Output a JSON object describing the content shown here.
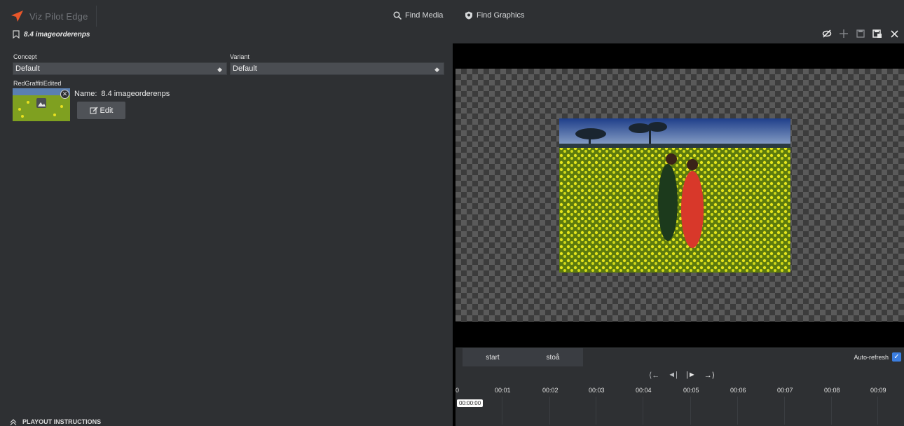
{
  "app": {
    "title": "Viz Pilot Edge"
  },
  "nav": {
    "find_media": "Find Media",
    "find_graphics": "Find Graphics"
  },
  "document": {
    "title": "8.4 imageorderenps"
  },
  "form": {
    "concept_label": "Concept",
    "concept_value": "Default",
    "variant_label": "Variant",
    "variant_value": "Default"
  },
  "asset": {
    "field_label": "RedGraffitiEdited",
    "name_label": "Name:",
    "name_value": "8.4 imageorderenps",
    "edit_label": "Edit"
  },
  "playout": {
    "label": "PLAYOUT INSTRUCTIONS"
  },
  "timeline": {
    "tabs": [
      "start",
      "stoå"
    ],
    "autorefresh_label": "Auto-refresh",
    "autorefresh_checked": true,
    "current_time": "00:00:00",
    "ticks": [
      "0",
      "00:01",
      "00:02",
      "00:03",
      "00:04",
      "00:05",
      "00:06",
      "00:07",
      "00:08",
      "00:09"
    ]
  },
  "colors": {
    "accent": "#e8562a",
    "checkbox": "#3b7ee0",
    "panel": "#2e3033"
  },
  "icons": [
    "logo-icon",
    "search-icon",
    "graphics-icon",
    "bookmark-icon",
    "hide-icon",
    "move-icon",
    "save-icon",
    "save-as-icon",
    "close-icon",
    "edit-icon",
    "expand-icon",
    "jump-start-icon",
    "step-back-icon",
    "play-icon",
    "jump-end-icon"
  ]
}
